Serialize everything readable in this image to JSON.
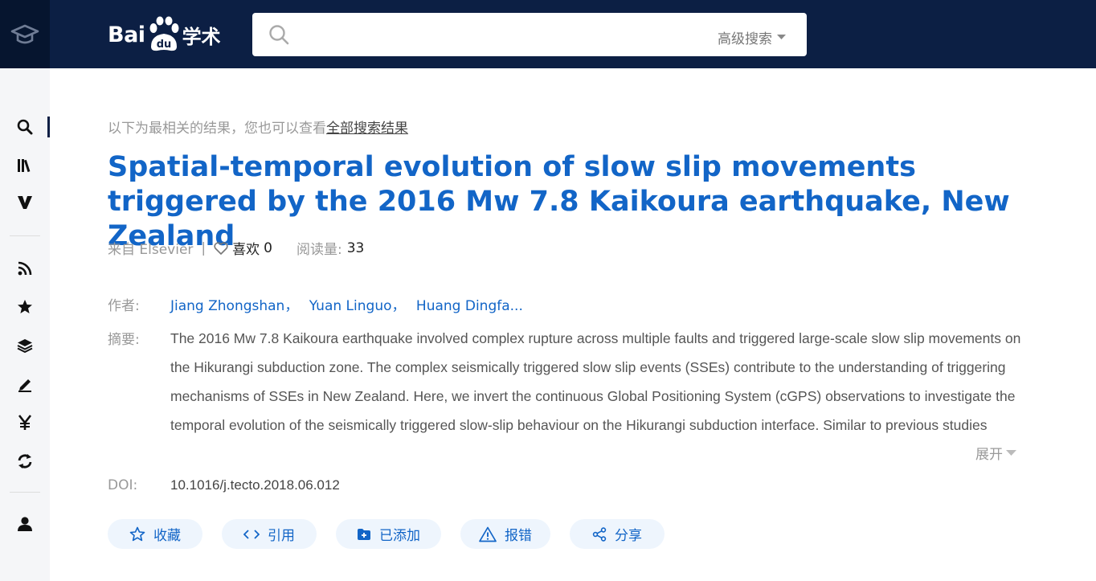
{
  "header": {
    "logo_bai": "Bai",
    "logo_du": "du",
    "logo_xueshu": "学术",
    "search_value": "",
    "advanced_search_label": "高级搜索"
  },
  "main": {
    "hint_prefix": "以下为最相关的结果，您也可以查看",
    "hint_link": "全部搜索结果",
    "title": "Spatial-temporal evolution of slow slip movements triggered by the 2016 Mw 7.8 Kaikoura earthquake, New Zealand",
    "source": "来自 Elsevier",
    "like_label": "喜欢",
    "like_count": "0",
    "reads_label": "阅读量:",
    "reads_count": "33",
    "authors_label": "作者:",
    "authors": [
      "Jiang Zhongshan，",
      "Yuan Linguo，",
      "Huang Dingfa..."
    ],
    "abstract_label": "摘要:",
    "abstract": "The 2016 Mw 7.8 Kaikoura earthquake involved complex rupture across multiple faults and triggered large-scale slow slip movements on the Hikurangi subduction zone. The complex seismically triggered slow slip events (SSEs) contribute to the understanding of triggering mechanisms of SSEs in New Zealand. Here, we invert the continuous Global Positioning System (cGPS) observations to investigate the temporal evolution of the seismically triggered slow-slip behaviour on the Hikurangi subduction interface. Similar to previous studies",
    "expand_label": "展开",
    "doi_label": "DOI:",
    "doi": "10.1016/j.tecto.2018.06.012"
  },
  "actions": [
    {
      "label": "收藏",
      "icon": "star-outline-icon"
    },
    {
      "label": "引用",
      "icon": "code-icon"
    },
    {
      "label": "已添加",
      "icon": "folder-plus-icon"
    },
    {
      "label": "报错",
      "icon": "warning-icon"
    },
    {
      "label": "分享",
      "icon": "share-icon"
    }
  ],
  "sidebar": {
    "items": [
      "search-icon",
      "library-icon",
      "v-icon",
      "rss-icon",
      "star-icon",
      "layers-icon",
      "edit-icon",
      "yen-icon",
      "refresh-icon",
      "user-icon"
    ]
  },
  "colors": {
    "header_bg": "#0c1f44",
    "link_blue": "#1265c7",
    "button_bg": "#eef5fd"
  }
}
